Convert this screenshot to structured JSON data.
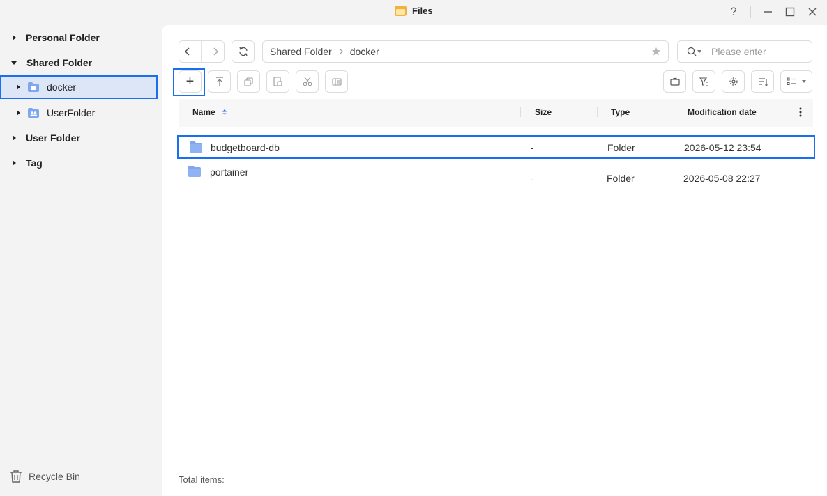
{
  "window": {
    "title": "Files",
    "help": "?",
    "minimize": "—",
    "close": "✕"
  },
  "sidebar": {
    "items": [
      {
        "label": "Personal Folder"
      },
      {
        "label": "Shared Folder"
      },
      {
        "label": "docker"
      },
      {
        "label": "UserFolder"
      },
      {
        "label": "User Folder"
      },
      {
        "label": "Tag"
      }
    ],
    "recycle_bin": "Recycle Bin"
  },
  "toolbar": {
    "breadcrumb": [
      "Shared Folder",
      "docker"
    ],
    "search_placeholder": "Please enter",
    "new_label": "+"
  },
  "table": {
    "columns": {
      "name": "Name",
      "size": "Size",
      "type": "Type",
      "modified": "Modification date"
    },
    "rows": [
      {
        "name": "budgetboard-db",
        "size": "-",
        "type": "Folder",
        "modified": "2026-05-12 23:54"
      },
      {
        "name": "portainer",
        "size": "-",
        "type": "Folder",
        "modified": "2026-05-08 22:27"
      }
    ]
  },
  "footer": {
    "total_label": "Total items:"
  },
  "colors": {
    "accent": "#1a6ff0",
    "folder": "#7fa7ef",
    "selected_bg": "#dce6f7"
  }
}
